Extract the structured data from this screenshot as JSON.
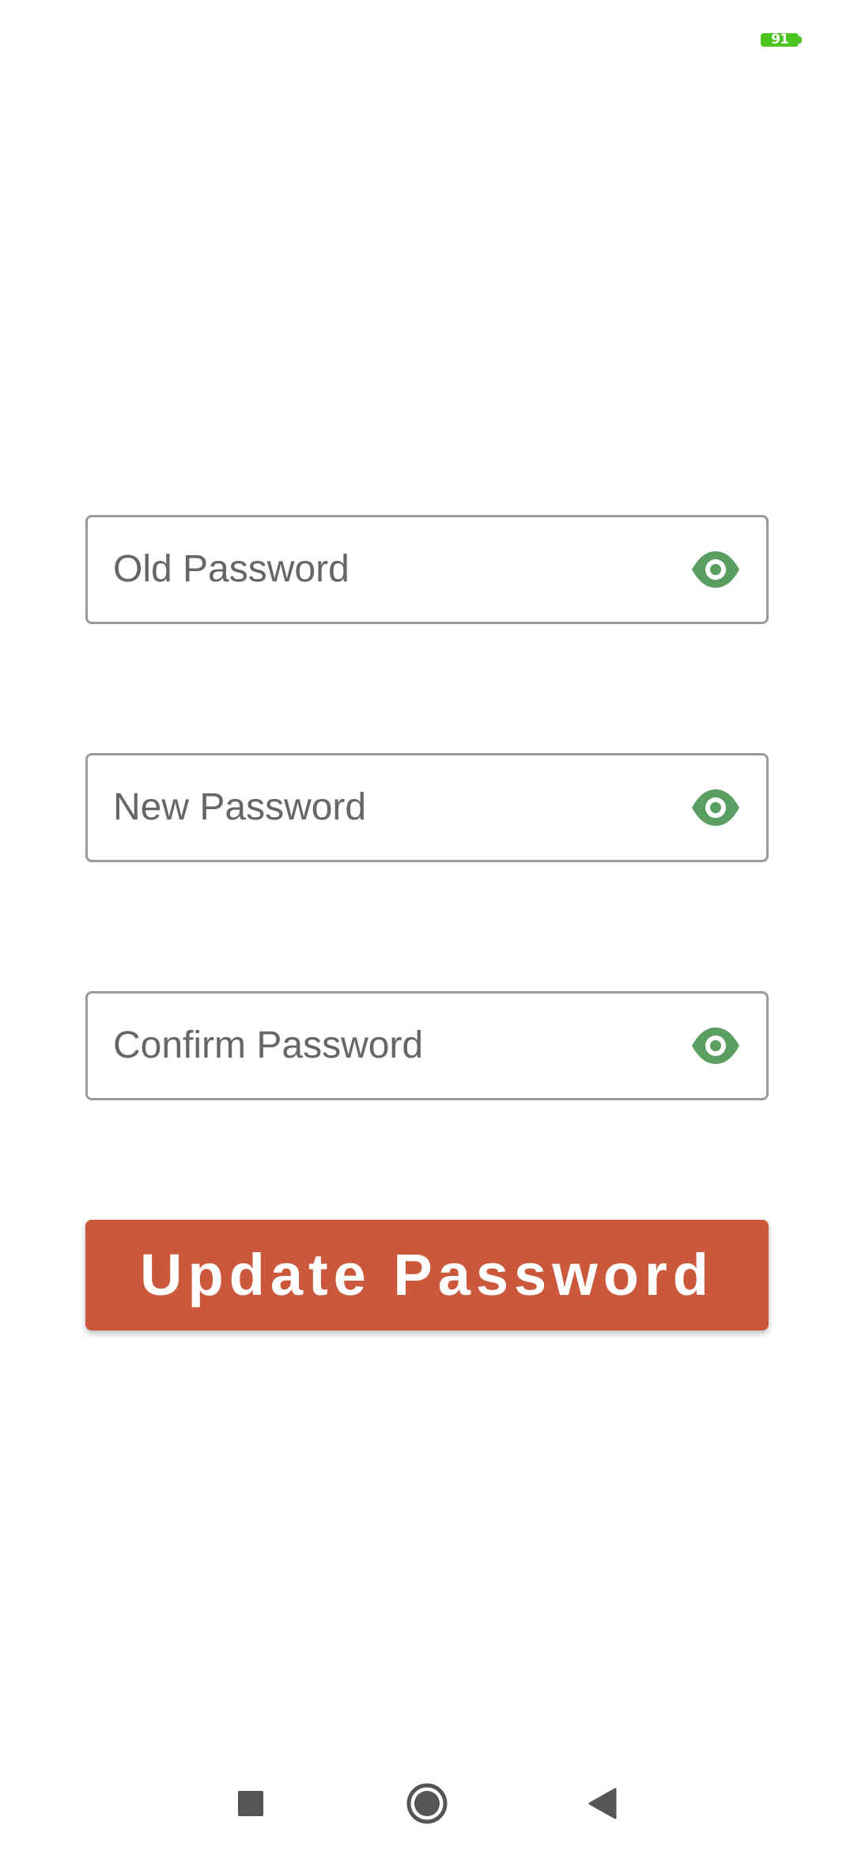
{
  "status_bar": {
    "battery_level": "91",
    "battery_color": "#4ac41f"
  },
  "form": {
    "old_password": {
      "placeholder": "Old Password",
      "value": "",
      "toggle_icon": "eye-icon"
    },
    "new_password": {
      "placeholder": "New Password",
      "value": "",
      "toggle_icon": "eye-icon"
    },
    "confirm_password": {
      "placeholder": "Confirm Password",
      "value": "",
      "toggle_icon": "eye-icon"
    },
    "submit_label": "Update Password"
  },
  "colors": {
    "accent_button": "#cb583b",
    "eye_icon": "#5a9e62",
    "field_border": "#9a9a9a"
  },
  "nav_bar": {
    "recents_icon": "square-icon",
    "home_icon": "circle-icon",
    "back_icon": "triangle-back-icon"
  }
}
